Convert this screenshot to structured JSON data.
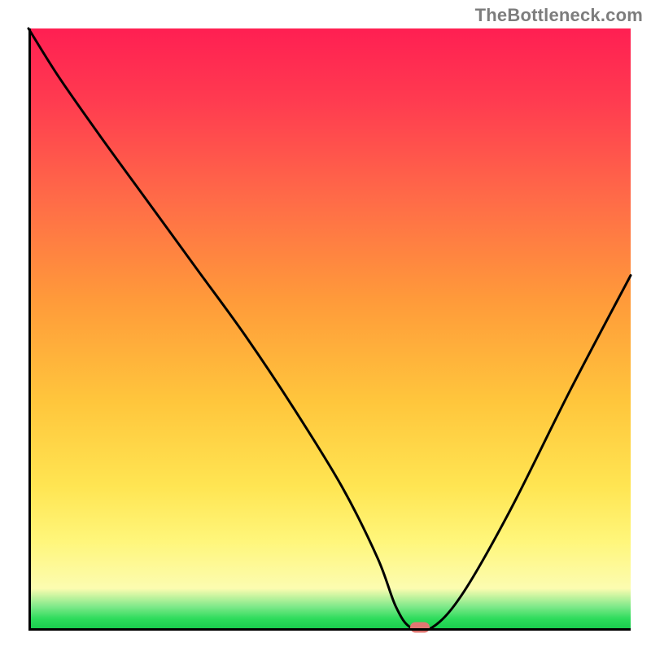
{
  "watermark": "TheBottleneck.com",
  "colors": {
    "axis": "#000000",
    "curve": "#000000",
    "marker": "#e17772",
    "gradient_stops": [
      "#ff1f52",
      "#ff3b50",
      "#ff6a48",
      "#ff9a3a",
      "#ffc63c",
      "#ffe552",
      "#fff67a",
      "#fcfcb0",
      "#7fe98a",
      "#2edc5c",
      "#15c94b"
    ]
  },
  "chart_data": {
    "type": "line",
    "title": "",
    "xlabel": "",
    "ylabel": "",
    "xlim": [
      0,
      100
    ],
    "ylim": [
      0,
      100
    ],
    "note": "x and y are normalized to the visible plot area; y=0 is the bottom axis (green), y=100 is the top (red). Values estimated from pixels.",
    "series": [
      {
        "name": "curve",
        "x": [
          0,
          5,
          12,
          20,
          28,
          36,
          44,
          52,
          58,
          61,
          63.5,
          67,
          72,
          80,
          90,
          100
        ],
        "y": [
          100,
          92,
          82,
          71,
          60,
          49,
          37,
          24,
          12,
          4,
          0.5,
          0.5,
          6,
          20,
          40,
          59
        ]
      }
    ],
    "marker": {
      "x": 65,
      "y": 0.5
    }
  }
}
